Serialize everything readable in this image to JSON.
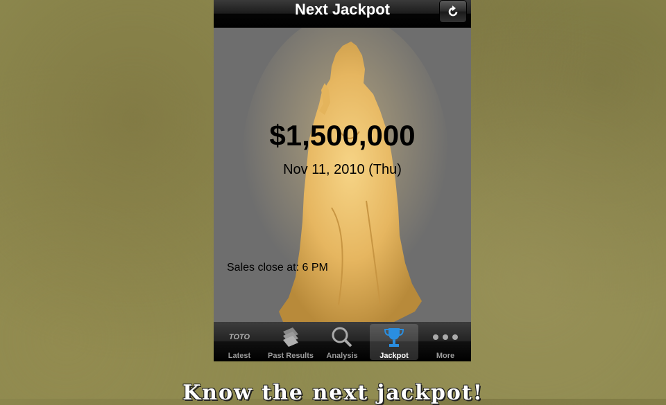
{
  "navbar": {
    "title": "Next Jackpot",
    "refresh_icon": "refresh-icon"
  },
  "jackpot": {
    "amount": "$1,500,000",
    "date": "Nov 11, 2010 (Thu)",
    "sales_close": "Sales close at: 6 PM"
  },
  "tabs": [
    {
      "label": "Latest",
      "icon": "toto-logo-icon",
      "active": false
    },
    {
      "label": "Past Results",
      "icon": "stacked-cards-icon",
      "active": false
    },
    {
      "label": "Analysis",
      "icon": "magnifier-toto-icon",
      "active": false
    },
    {
      "label": "Jackpot",
      "icon": "trophy-icon",
      "active": true
    },
    {
      "label": "More",
      "icon": "more-dots-icon",
      "active": false
    }
  ],
  "toto_icon_text": "TOTO",
  "caption": "Know the next jackpot!",
  "colors": {
    "accent_trophy": "#2a8ee0",
    "statue_glow": "#f0c060"
  }
}
